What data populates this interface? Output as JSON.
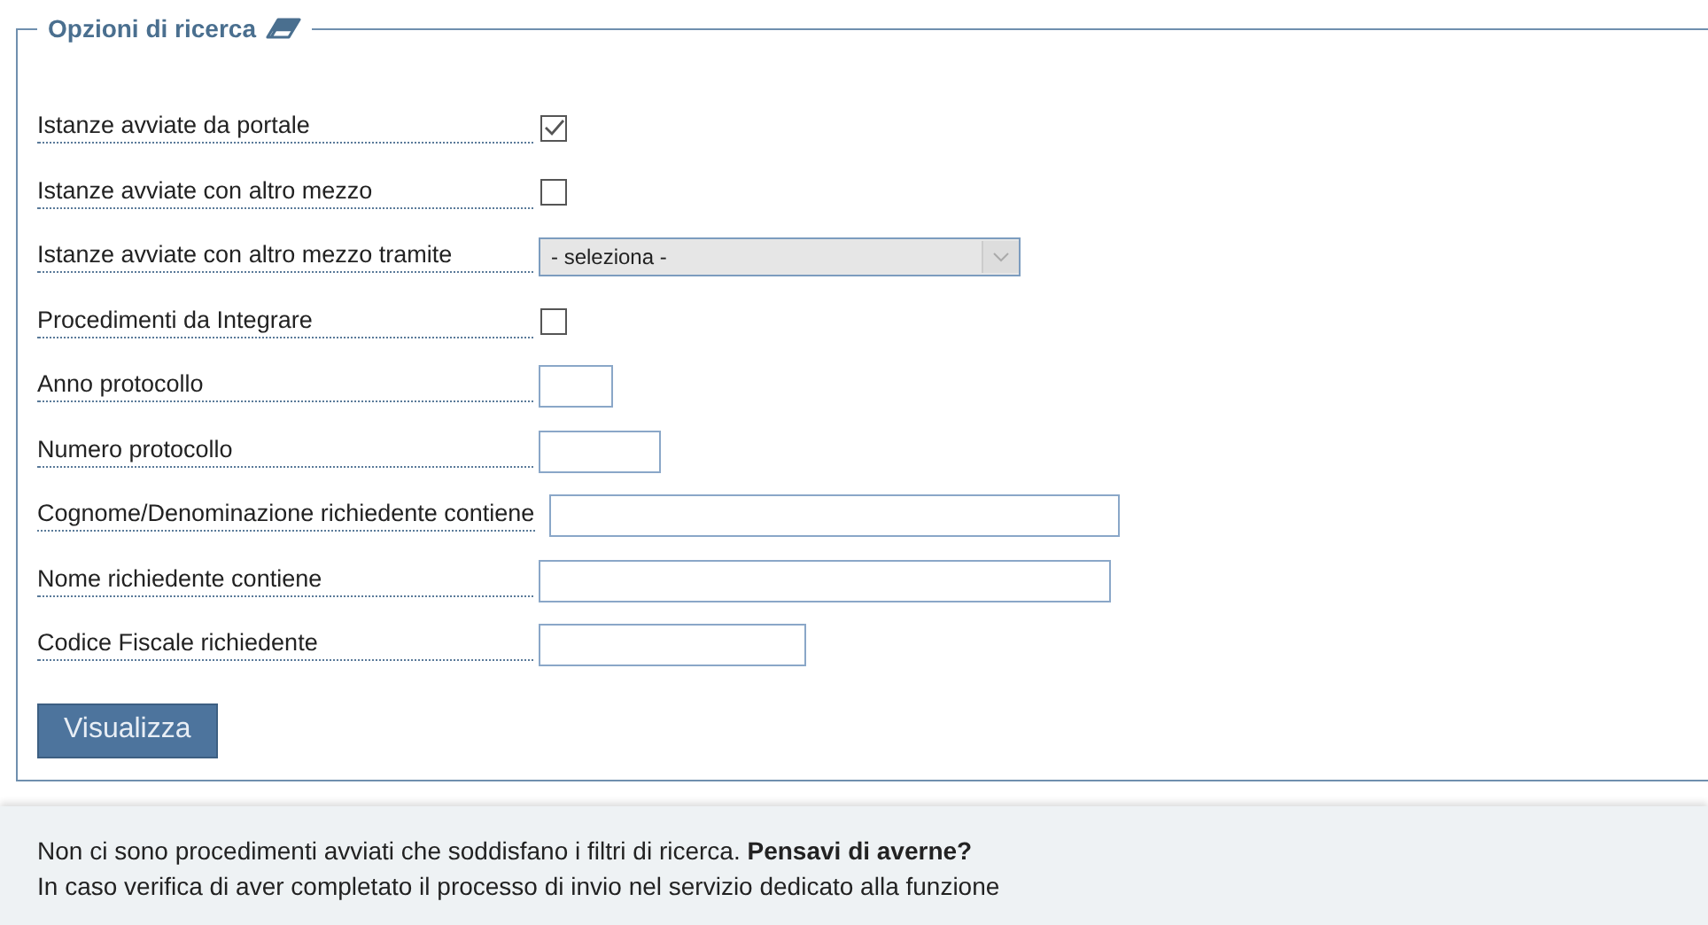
{
  "panel": {
    "title": "Opzioni di ricerca"
  },
  "fields": [
    {
      "kind": "checkbox",
      "label": "Istanze avviate da portale",
      "checked": true
    },
    {
      "kind": "checkbox",
      "label": "Istanze avviate con altro mezzo",
      "checked": false
    },
    {
      "kind": "select",
      "label": "Istanze avviate con altro mezzo tramite",
      "value": "- seleziona -"
    },
    {
      "kind": "checkbox",
      "label": "Procedimenti da Integrare",
      "checked": false
    },
    {
      "kind": "text",
      "label": "Anno protocollo"
    },
    {
      "kind": "text",
      "label": "Numero protocollo"
    },
    {
      "kind": "text",
      "label": "Cognome/Denominazione richiedente contiene"
    },
    {
      "kind": "text",
      "label": "Nome richiedente contiene"
    },
    {
      "kind": "text",
      "label": "Codice Fiscale richiedente"
    }
  ],
  "button": "Visualizza",
  "message": {
    "line_1": "Non ci sono procedimenti avviati che soddisfano i filtri di ricerca. **Pensavi di averne?**",
    "line_2": "In caso verifica di aver completato il processo di invio nel servizio dedicato alla funzione"
  }
}
